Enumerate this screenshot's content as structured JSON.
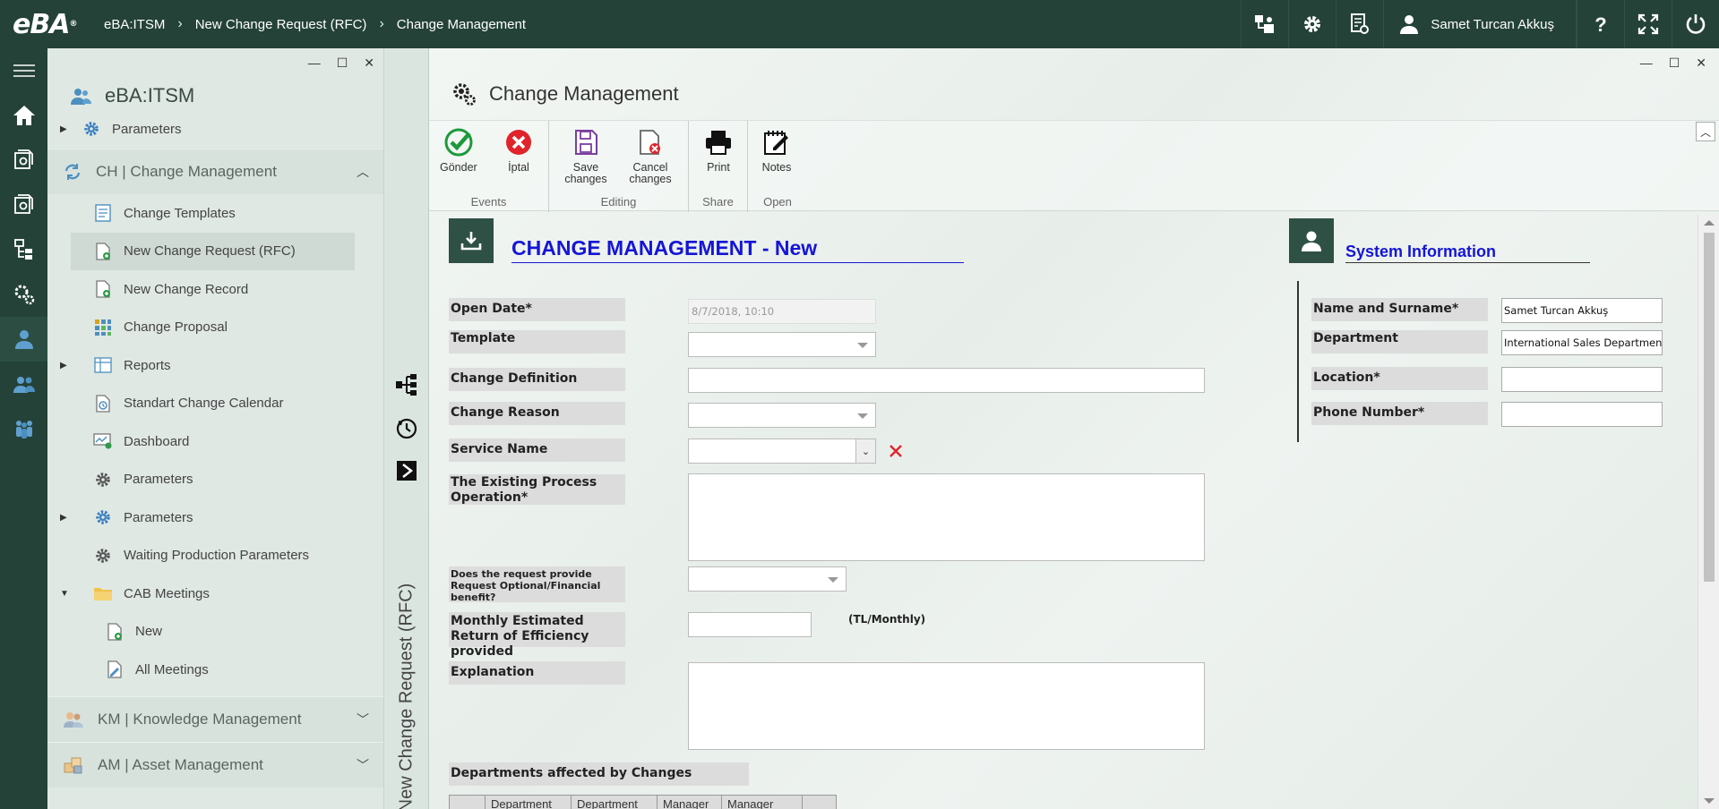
{
  "app": {
    "logo": "eBA",
    "logo_sup": "®"
  },
  "topbar": {
    "breadcrumb": [
      "eBA:ITSM",
      "New Change Request (RFC)",
      "Change Management"
    ],
    "user_name": "Samet Turcan Akkuş",
    "icons": [
      "org-chart-icon",
      "gear-icon",
      "document-settings-icon",
      "user-icon",
      "help-icon",
      "fullscreen-icon",
      "power-icon"
    ]
  },
  "sidebar": {
    "title": "eBA:ITSM",
    "items": [
      {
        "label": "Parameters",
        "icon": "gear-icon",
        "expandable": true
      },
      {
        "label": "CH | Change Management",
        "group": true
      },
      {
        "label": "Change Templates",
        "icon": "template-icon"
      },
      {
        "label": "New Change Request (RFC)",
        "icon": "new-document-icon",
        "selected": true
      },
      {
        "label": "New Change Record",
        "icon": "new-document-icon"
      },
      {
        "label": "Change Proposal",
        "icon": "grid-icon"
      },
      {
        "label": "Reports",
        "icon": "report-icon",
        "expandable": true
      },
      {
        "label": "Standart Change Calendar",
        "icon": "calendar-icon"
      },
      {
        "label": "Dashboard",
        "icon": "dashboard-icon"
      },
      {
        "label": "Parameters",
        "icon": "gear-icon"
      },
      {
        "label": "Parameters",
        "icon": "gear-icon",
        "expandable": true
      },
      {
        "label": "Waiting Production Parameters",
        "icon": "gear-icon"
      },
      {
        "label": "CAB Meetings",
        "icon": "folder-icon",
        "expanded": true
      },
      {
        "label": "New",
        "icon": "new-document-icon"
      },
      {
        "label": "All Meetings",
        "icon": "edit-document-icon"
      }
    ],
    "groups_bottom": [
      "KM | Knowledge Management",
      "AM | Asset Management"
    ]
  },
  "vstrip": {
    "label": "New Change Request (RFC)"
  },
  "main": {
    "title": "Change Management",
    "ribbon": {
      "groups": [
        {
          "label": "Events",
          "buttons": [
            "Gönder",
            "İptal"
          ]
        },
        {
          "label": "Editing",
          "buttons": [
            "Save changes",
            "Cancel changes"
          ]
        },
        {
          "label": "Share",
          "buttons": [
            "Print"
          ]
        },
        {
          "label": "Open",
          "buttons": [
            "Notes"
          ]
        }
      ]
    },
    "form": {
      "title": "CHANGE MANAGEMENT - New",
      "fields": {
        "open_date": {
          "label": "Open Date*",
          "value": "8/7/2018, 10:10"
        },
        "template": {
          "label": "Template",
          "value": ""
        },
        "change_definition": {
          "label": "Change Definition",
          "value": ""
        },
        "change_reason": {
          "label": "Change Reason",
          "value": ""
        },
        "service_name": {
          "label": "Service Name",
          "value": ""
        },
        "existing_process": {
          "label": "The Existing Process Operation*",
          "value": ""
        },
        "financial_benefit": {
          "label": "Does the request provide Request Optional/Financial benefit?",
          "value": ""
        },
        "monthly_return": {
          "label": "Monthly Estimated Return of Efficiency provided",
          "value": "",
          "unit": "(TL/Monthly)"
        },
        "explanation": {
          "label": "Explanation",
          "value": ""
        },
        "departments_affected": {
          "label": "Departments affected by Changes"
        }
      },
      "dept_table": {
        "columns": [
          "",
          "Department",
          "Department",
          "Manager",
          "Manager",
          ""
        ]
      }
    },
    "system_info": {
      "title": "System Information",
      "fields": {
        "name": {
          "label": "Name and Surname*",
          "value": "Samet Turcan Akkuş"
        },
        "department": {
          "label": "Department",
          "value": "International Sales Department"
        },
        "location": {
          "label": "Location*",
          "value": ""
        },
        "phone": {
          "label": "Phone Number*",
          "value": ""
        }
      }
    }
  }
}
